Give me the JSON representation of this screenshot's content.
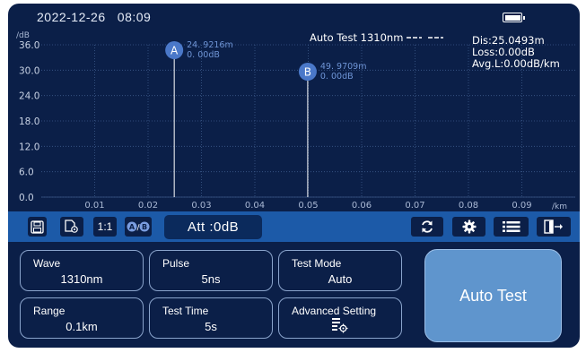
{
  "status": {
    "date": "2022-12-26",
    "time": "08:09"
  },
  "graph": {
    "y_unit": "/dB",
    "x_unit": "/km",
    "y_ticks": [
      "36.0",
      "30.0",
      "24.0",
      "18.0",
      "12.0",
      "6.0",
      "0.0"
    ],
    "x_ticks": [
      "0.01",
      "0.02",
      "0.03",
      "0.04",
      "0.05",
      "0.06",
      "0.07",
      "0.08",
      "0.09"
    ],
    "x_range": [
      0,
      0.1
    ],
    "y_range": [
      0,
      36
    ],
    "legend_label": "Auto Test 1310nm",
    "info": {
      "dis": "Dis:25.0493m",
      "loss": "Loss:0.00dB",
      "avgl": "Avg.L:0.00dB/km"
    },
    "marker_a": {
      "label": "A",
      "position_km": 0.0249,
      "distance": "24. 9216m",
      "loss": "0. 00dB"
    },
    "marker_b": {
      "label": "B",
      "position_km": 0.0499,
      "distance": "49. 9709m",
      "loss": "0. 00dB"
    },
    "colors": {
      "background": "#0b1f48",
      "grid": "#3d5a8a",
      "marker": "#4a78c9",
      "marker_text": "#6f95d6"
    }
  },
  "toolbar": {
    "save_icon": "floppy-disk-icon",
    "file_icon": "file-settings-icon",
    "ratio_label": "1:1",
    "ab_icon": "ab-marker-icon",
    "att_label": "Att :0dB",
    "refresh_icon": "refresh-icon",
    "settings_icon": "gear-icon",
    "list_icon": "list-icon",
    "exit_icon": "exit-icon"
  },
  "params": {
    "wave": {
      "label": "Wave",
      "value": "1310nm"
    },
    "pulse": {
      "label": "Pulse",
      "value": "5ns"
    },
    "test_mode": {
      "label": "Test Mode",
      "value": "Auto"
    },
    "range": {
      "label": "Range",
      "value": "0.1km"
    },
    "test_time": {
      "label": "Test Time",
      "value": "5s"
    },
    "advanced": {
      "label": "Advanced Setting",
      "icon": "advanced-settings-icon"
    }
  },
  "auto_test_button": "Auto Test"
}
